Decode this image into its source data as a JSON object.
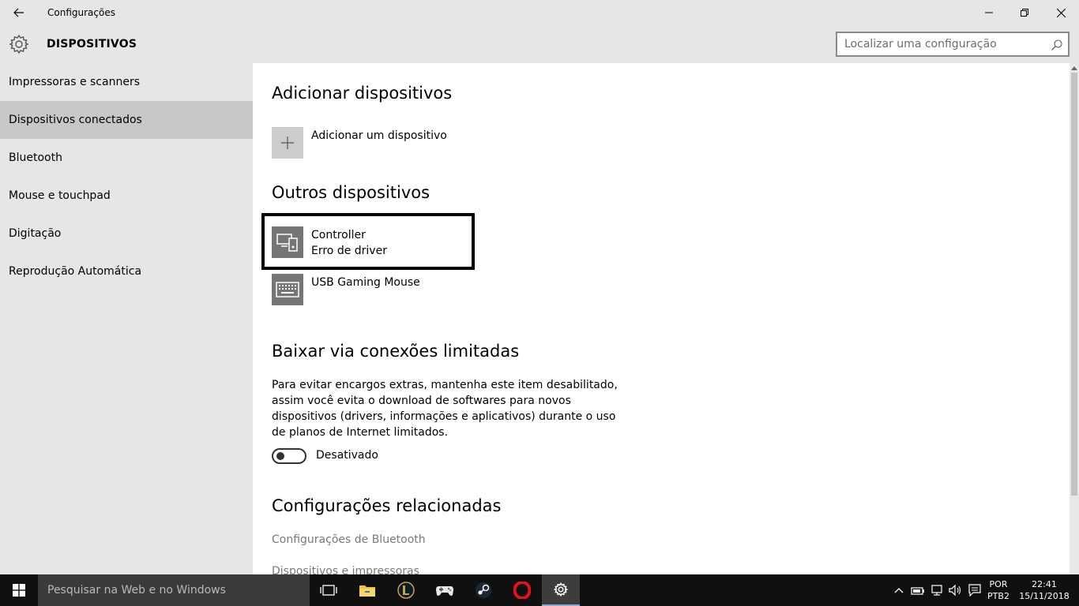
{
  "window": {
    "title": "Configurações"
  },
  "header": {
    "title": "DISPOSITIVOS",
    "search_placeholder": "Localizar uma configuração"
  },
  "sidebar": {
    "items": [
      {
        "label": "Impressoras e scanners"
      },
      {
        "label": "Dispositivos conectados",
        "selected": true
      },
      {
        "label": "Bluetooth"
      },
      {
        "label": "Mouse e touchpad"
      },
      {
        "label": "Digitação"
      },
      {
        "label": "Reprodução Automática"
      }
    ]
  },
  "main": {
    "add_section": {
      "title": "Adicionar dispositivos",
      "add_label": "Adicionar um dispositivo"
    },
    "other_section": {
      "title": "Outros dispositivos",
      "devices": [
        {
          "name": "Controller",
          "status": "Erro de driver",
          "icon": "device-icon"
        },
        {
          "name": "USB Gaming Mouse",
          "status": "",
          "icon": "keyboard-icon"
        }
      ]
    },
    "metered_section": {
      "title": "Baixar via conexões limitadas",
      "description": "Para evitar encargos extras, mantenha este item desabilitado, assim você evita o download de softwares para novos dispositivos (drivers, informações e aplicativos) durante o uso de planos de Internet limitados.",
      "toggle_label": "Desativado",
      "toggle_on": false
    },
    "related_section": {
      "title": "Configurações relacionadas",
      "links": [
        "Configurações de Bluetooth",
        "Dispositivos e impressoras"
      ]
    }
  },
  "taskbar": {
    "search_placeholder": "Pesquisar na Web e no Windows",
    "apps": [
      "task-view",
      "file-explorer",
      "league-of-legends",
      "game-controller",
      "steam",
      "opera",
      "settings"
    ],
    "tray": {
      "lang_top": "POR",
      "lang_bottom": "PTB2",
      "time": "22:41",
      "date": "15/11/2018"
    }
  },
  "colors": {
    "sidebar_bg": "#e6e6e6",
    "selected_bg": "#c8c8c8",
    "taskbar_bg": "#101010",
    "link": "#7a7a7a"
  }
}
